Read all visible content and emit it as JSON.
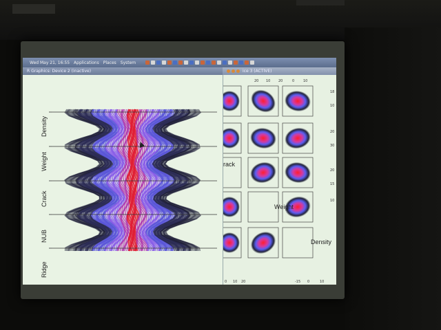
{
  "topbar": {
    "clock": "Wed May 21, 16:55",
    "menu_applications": "Applications",
    "menu_places": "Places",
    "menu_system": "System"
  },
  "windows": {
    "graphics_title": "R Graphics: Device 2 (inactive)",
    "scatter_title": "ice 3 (ACTIVE)"
  },
  "parallel_plot": {
    "axes": [
      "Density",
      "Weight",
      "Crack",
      "NUB",
      "Ridge"
    ]
  },
  "scatter_matrix": {
    "diag_labels": [
      "rack",
      "Weight",
      "Density"
    ],
    "top_ticks": [
      "20",
      "10",
      "20",
      "0",
      "10"
    ],
    "bottom_ticks": [
      "0",
      "10",
      "20",
      "-15",
      "0",
      "10"
    ],
    "right_ticks": [
      "18",
      "10",
      "20",
      "30",
      "20",
      "15",
      "10"
    ]
  },
  "colors": {
    "cloud_core": "#e0203a",
    "cloud_mid": "#7a4fe0",
    "cloud_outer": "#1a1a40",
    "lines": "#2a2a44"
  }
}
